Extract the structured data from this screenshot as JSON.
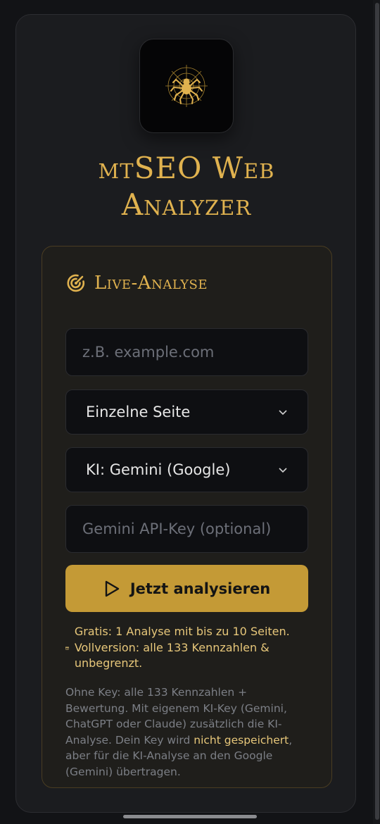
{
  "app": {
    "title": "mtSEO Web\nAnalyzer",
    "logo_icon": "spider-web-icon"
  },
  "analysis": {
    "section_title": "Live-Analyse",
    "section_icon": "radar-icon",
    "url_input": {
      "value": "",
      "placeholder": "z.B. example.com"
    },
    "scope_select": {
      "selected": "Einzelne Seite"
    },
    "ai_select": {
      "selected": "KI: Gemini (Google)"
    },
    "api_key_input": {
      "value": "",
      "placeholder": "Gemini API-Key (optional)"
    },
    "analyze_button": {
      "label": "Jetzt analysieren",
      "icon": "play-icon"
    },
    "free_note": {
      "icon": "gift-icon",
      "text": "Gratis: 1 Analyse mit bis zu 10 Seiten. Vollversion: alle 133 Kennzahlen & unbegrenzt."
    },
    "fine_print": {
      "before": "Ohne Key: alle 133 Kennzahlen + Bewertung. Mit eigenem KI-Key (Gemini, ChatGPT oder Claude) zusätzlich die KI-Analyse. Dein Key wird ",
      "highlight": "nicht gespeichert",
      "after": ", aber für die KI-Analyse an den Google (Gemini) übertragen."
    }
  },
  "colors": {
    "accent": "#e0b24f",
    "button": "#c49a36",
    "background": "#121316",
    "card": "#1b1c1f"
  }
}
